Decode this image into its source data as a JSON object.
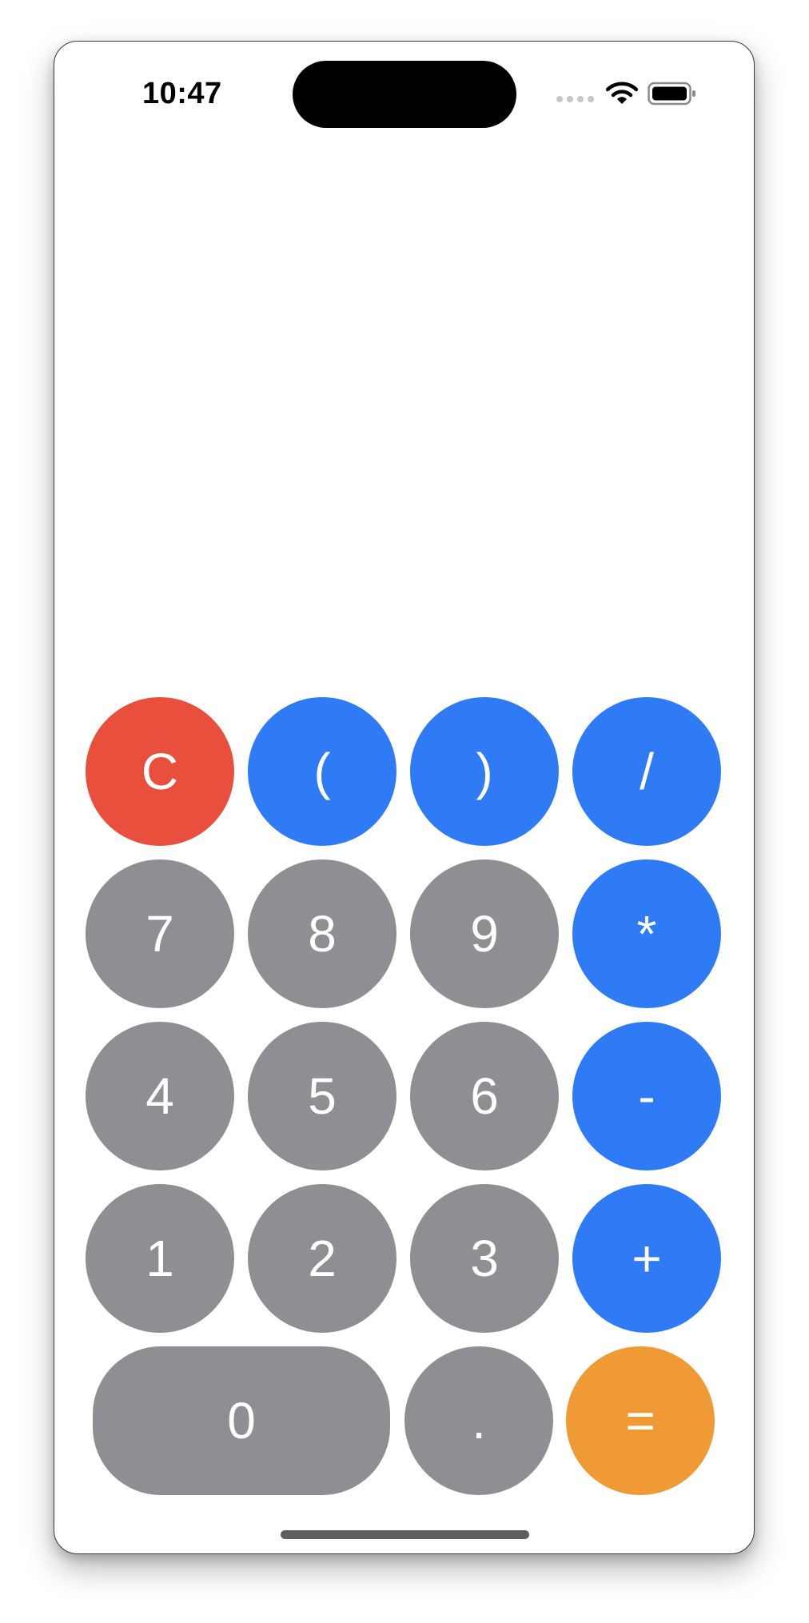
{
  "status_bar": {
    "time": "10:47"
  },
  "keypad": {
    "row1": [
      "C",
      "(",
      ")",
      "/"
    ],
    "row2": [
      "7",
      "8",
      "9",
      "*"
    ],
    "row3": [
      "4",
      "5",
      "6",
      "-"
    ],
    "row4": [
      "1",
      "2",
      "3",
      "+"
    ],
    "row5": [
      "0",
      ".",
      "="
    ]
  },
  "colors": {
    "digit": "#8e8e93",
    "operator": "#2f7bf5",
    "clear": "#e94f3d",
    "equals": "#ef9a35"
  },
  "icons": {
    "signal": "cellular-signal-icon",
    "wifi": "wifi-icon",
    "battery": "battery-icon"
  }
}
